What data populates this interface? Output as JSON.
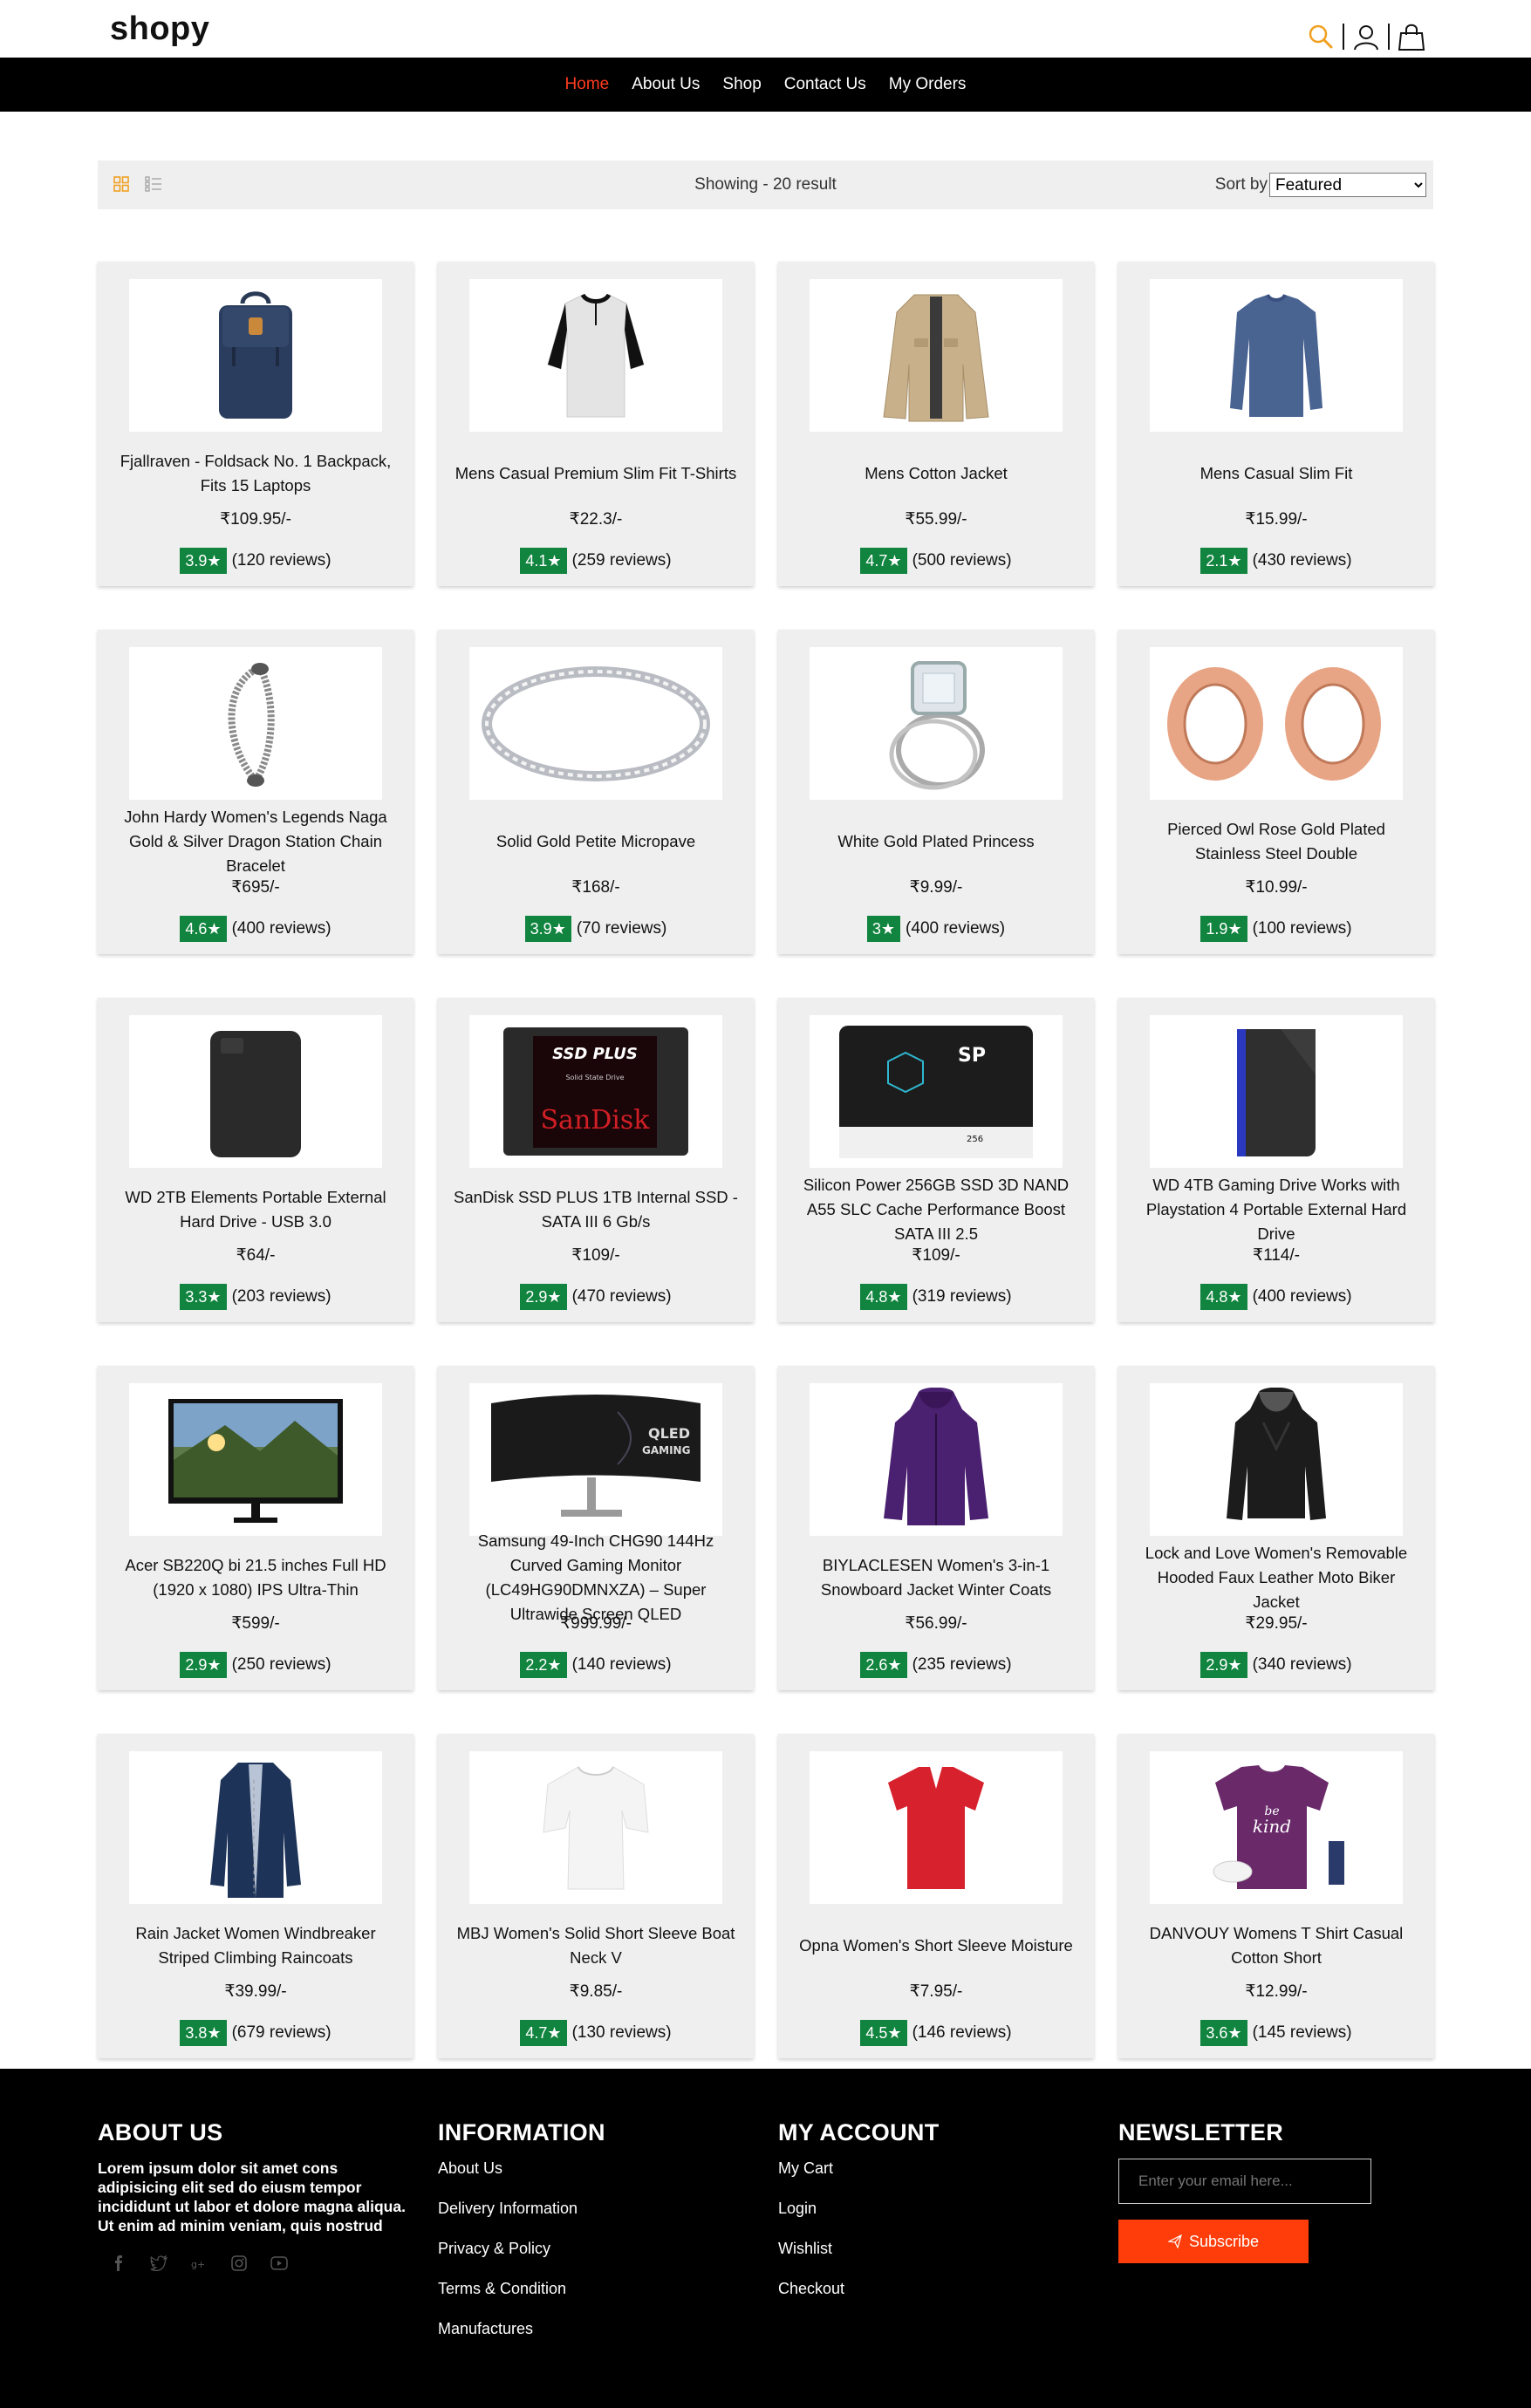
{
  "header": {
    "logo": "shopy",
    "icons": [
      "search-icon",
      "user-icon",
      "bag-icon"
    ],
    "accent": "#ff3b1f"
  },
  "nav": {
    "items": [
      {
        "label": "Home",
        "active": true
      },
      {
        "label": "About Us",
        "active": false
      },
      {
        "label": "Shop",
        "active": false
      },
      {
        "label": "Contact Us",
        "active": false
      },
      {
        "label": "My Orders",
        "active": false
      }
    ]
  },
  "toolbar": {
    "showing": "Showing - 20 result",
    "sort_label": "Sort by",
    "sort_selected": "Featured"
  },
  "products": [
    {
      "title": "Fjallraven - Foldsack No. 1 Backpack, Fits 15 Laptops",
      "price": "₹109.95/-",
      "rating": "3.9★",
      "reviews": "(120 reviews)",
      "image": "backpack"
    },
    {
      "title": "Mens Casual Premium Slim Fit T-Shirts",
      "price": "₹22.3/-",
      "rating": "4.1★",
      "reviews": "(259 reviews)",
      "image": "tshirt"
    },
    {
      "title": "Mens Cotton Jacket",
      "price": "₹55.99/-",
      "rating": "4.7★",
      "reviews": "(500 reviews)",
      "image": "jacket"
    },
    {
      "title": "Mens Casual Slim Fit",
      "price": "₹15.99/-",
      "rating": "2.1★",
      "reviews": "(430 reviews)",
      "image": "longsleeve"
    },
    {
      "title": "John Hardy Women's Legends Naga Gold & Silver Dragon Station Chain Bracelet",
      "price": "₹695/-",
      "rating": "4.6★",
      "reviews": "(400 reviews)",
      "image": "bracelet"
    },
    {
      "title": "Solid Gold Petite Micropave",
      "price": "₹168/-",
      "rating": "3.9★",
      "reviews": "(70 reviews)",
      "image": "ring"
    },
    {
      "title": "White Gold Plated Princess",
      "price": "₹9.99/-",
      "rating": "3★",
      "reviews": "(400 reviews)",
      "image": "princess-ring"
    },
    {
      "title": "Pierced Owl Rose Gold Plated Stainless Steel Double",
      "price": "₹10.99/-",
      "rating": "1.9★",
      "reviews": "(100 reviews)",
      "image": "plugs"
    },
    {
      "title": "WD 2TB Elements Portable External Hard Drive - USB 3.0",
      "price": "₹64/-",
      "rating": "3.3★",
      "reviews": "(203 reviews)",
      "image": "harddrive"
    },
    {
      "title": "SanDisk SSD PLUS 1TB Internal SSD - SATA III 6 Gb/s",
      "price": "₹109/-",
      "rating": "2.9★",
      "reviews": "(470 reviews)",
      "image": "sandisk"
    },
    {
      "title": "Silicon Power 256GB SSD 3D NAND A55 SLC Cache Performance Boost SATA III 2.5",
      "price": "₹109/-",
      "rating": "4.8★",
      "reviews": "(319 reviews)",
      "image": "sp-ssd"
    },
    {
      "title": "WD 4TB Gaming Drive Works with Playstation 4 Portable External Hard Drive",
      "price": "₹114/-",
      "rating": "4.8★",
      "reviews": "(400 reviews)",
      "image": "wd-gaming"
    },
    {
      "title": "Acer SB220Q bi 21.5 inches Full HD (1920 x 1080) IPS Ultra-Thin",
      "price": "₹599/-",
      "rating": "2.9★",
      "reviews": "(250 reviews)",
      "image": "monitor"
    },
    {
      "title": "Samsung 49-Inch CHG90 144Hz Curved Gaming Monitor (LC49HG90DMNXZA) – Super Ultrawide Screen QLED",
      "price": "₹999.99/-",
      "rating": "2.2★",
      "reviews": "(140 reviews)",
      "image": "curved-monitor"
    },
    {
      "title": "BIYLACLESEN Women's 3-in-1 Snowboard Jacket Winter Coats",
      "price": "₹56.99/-",
      "rating": "2.6★",
      "reviews": "(235 reviews)",
      "image": "purple-jacket"
    },
    {
      "title": "Lock and Love Women's Removable Hooded Faux Leather Moto Biker Jacket",
      "price": "₹29.95/-",
      "rating": "2.9★",
      "reviews": "(340 reviews)",
      "image": "leather-jacket"
    },
    {
      "title": "Rain Jacket Women Windbreaker Striped Climbing Raincoats",
      "price": "₹39.99/-",
      "rating": "3.8★",
      "reviews": "(679 reviews)",
      "image": "raincoat"
    },
    {
      "title": "MBJ Women's Solid Short Sleeve Boat Neck V",
      "price": "₹9.85/-",
      "rating": "4.7★",
      "reviews": "(130 reviews)",
      "image": "white-top"
    },
    {
      "title": "Opna Women's Short Sleeve Moisture",
      "price": "₹7.95/-",
      "rating": "4.5★",
      "reviews": "(146 reviews)",
      "image": "red-shirt"
    },
    {
      "title": "DANVOUY Womens T Shirt Casual Cotton Short",
      "price": "₹12.99/-",
      "rating": "3.6★",
      "reviews": "(145 reviews)",
      "image": "purple-tee"
    }
  ],
  "rating_color": "#11843f",
  "footer": {
    "about": {
      "heading": "ABOUT US",
      "text": "Lorem ipsum dolor sit amet cons adipisicing elit sed do eiusm tempor incididunt ut labor et dolore magna aliqua. Ut enim ad minim veniam, quis nostrud",
      "social": [
        "facebook-icon",
        "twitter-icon",
        "google-plus-icon",
        "instagram-icon",
        "youtube-icon"
      ]
    },
    "information": {
      "heading": "INFORMATION",
      "links": [
        "About Us",
        "Delivery Information",
        "Privacy & Policy",
        "Terms & Condition",
        "Manufactures"
      ]
    },
    "account": {
      "heading": "MY ACCOUNT",
      "links": [
        "My Cart",
        "Login",
        "Wishlist",
        "Checkout"
      ]
    },
    "newsletter": {
      "heading": "NEWSLETTER",
      "placeholder": "Enter your email here...",
      "button": "Subscribe",
      "button_color": "#ff3d0a"
    }
  }
}
